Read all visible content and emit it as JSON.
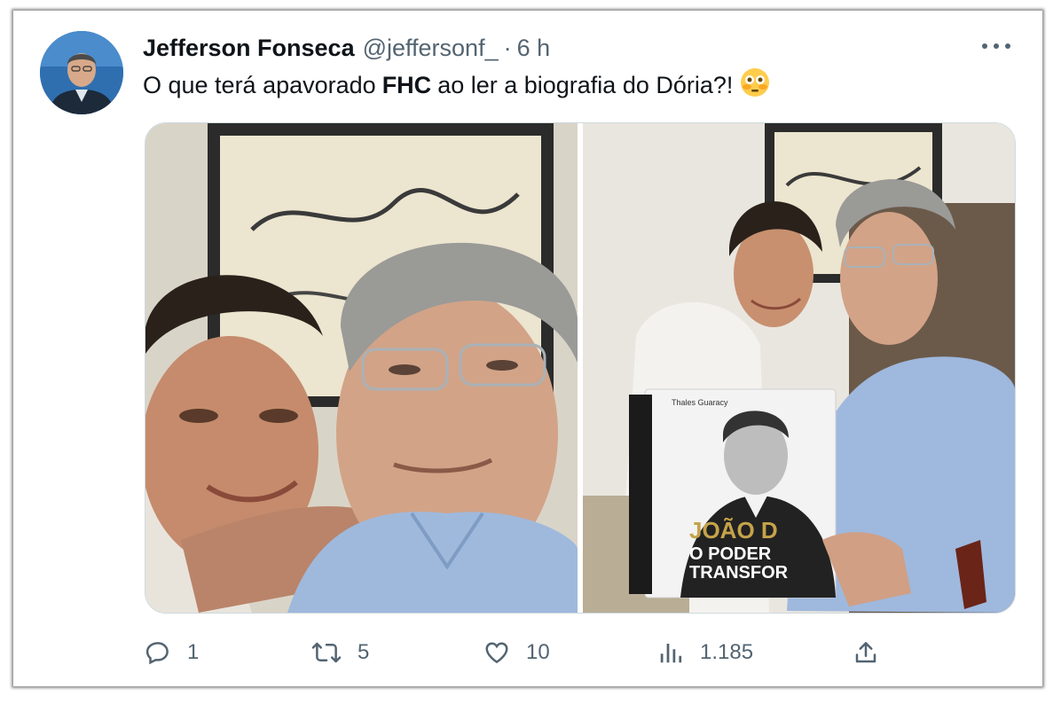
{
  "tweet": {
    "author_name": "Jefferson Fonseca",
    "handle": "@jeffersonf_",
    "separator": "·",
    "time": "6 h",
    "text_before": "O que terá apavorado",
    "text_bold": "FHC",
    "text_after": "ao ler a biografia do Dória?!",
    "emoji": "flushed-face-emoji",
    "media_count": 2,
    "book_cover": {
      "author_line": "Thales Guaracy",
      "title_line1": "JOÃO D",
      "title_line2": "O PODER",
      "title_line3": "TRANSFOR"
    }
  },
  "actions": {
    "reply_icon": "reply-icon",
    "reply_count": "1",
    "retweet_icon": "retweet-icon",
    "retweet_count": "5",
    "like_icon": "heart-icon",
    "like_count": "10",
    "views_icon": "views-icon",
    "views_count": "1.185",
    "share_icon": "share-icon"
  },
  "colors": {
    "primary_text": "#0f1419",
    "secondary_text": "#536471",
    "border": "#cfd9de"
  }
}
